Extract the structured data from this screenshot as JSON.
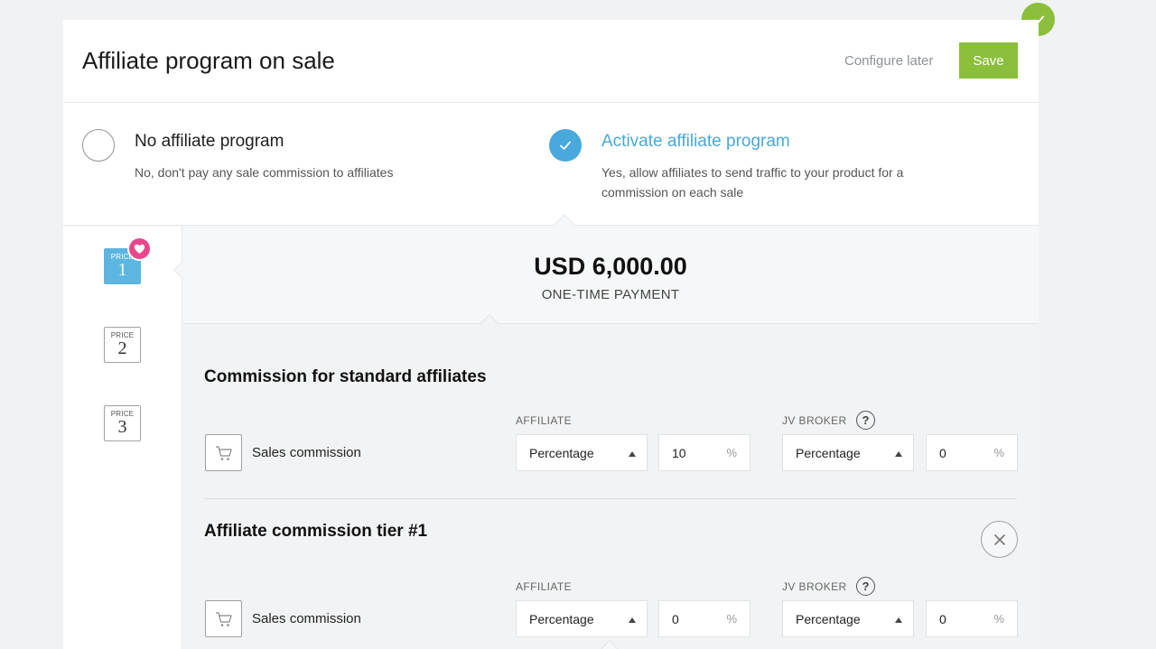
{
  "header": {
    "title": "Affiliate program on sale",
    "configure_later": "Configure later",
    "save_label": "Save"
  },
  "options": {
    "no_program": {
      "title": "No affiliate program",
      "description": "No, don't pay any sale commission to affiliates",
      "selected": false
    },
    "activate": {
      "title": "Activate affiliate program",
      "description": "Yes, allow affiliates to send traffic to your product for a commission on each sale",
      "selected": true
    }
  },
  "prices": [
    {
      "label": "PRICE",
      "number": "1",
      "active": true,
      "favorite": true
    },
    {
      "label": "PRICE",
      "number": "2",
      "active": false
    },
    {
      "label": "PRICE",
      "number": "3",
      "active": false
    }
  ],
  "price_detail": {
    "amount": "USD 6,000.00",
    "type": "ONE-TIME PAYMENT"
  },
  "sections": [
    {
      "title": "Commission for standard affiliates",
      "affiliate_label": "AFFILIATE",
      "jv_label": "JV BROKER",
      "row_label": "Sales commission",
      "affiliate_type": "Percentage",
      "affiliate_value": "10",
      "jv_type": "Percentage",
      "jv_value": "0",
      "unit": "%"
    },
    {
      "title": "Affiliate commission tier #1",
      "affiliate_label": "AFFILIATE",
      "jv_label": "JV BROKER",
      "row_label": "Sales commission",
      "affiliate_type": "Percentage",
      "affiliate_value": "0",
      "jv_type": "Percentage",
      "jv_value": "0",
      "unit": "%"
    }
  ],
  "help_glyph": "?",
  "colors": {
    "accent_green": "#8bbf3b",
    "accent_blue": "#49a8dc",
    "price_active": "#5cb6e0",
    "favorite_pink": "#e8478c"
  },
  "icons": [
    "check-icon",
    "heart-icon",
    "cart-icon",
    "help-icon",
    "close-icon"
  ]
}
